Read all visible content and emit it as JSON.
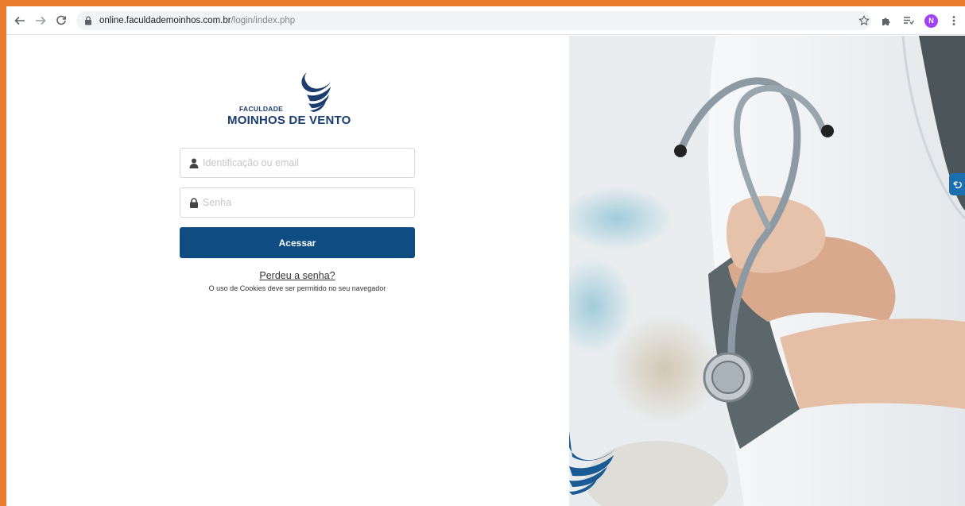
{
  "browser": {
    "url_host": "online.faculdademoinhos.com.br",
    "url_path": "/login/index.php",
    "profile_initial": "N"
  },
  "brand": {
    "name_small": "FACULDADE",
    "name_big": "MOINHOS DE VENTO",
    "color": "#1a3d6d"
  },
  "login": {
    "username_placeholder": "Identificação ou email",
    "password_placeholder": "Senha",
    "submit_label": "Acessar",
    "forgot_label": "Perdeu a senha?",
    "cookie_note": "O uso de Cookies deve ser permitido no seu navegador",
    "button_color": "#0f4c81"
  },
  "icons": {
    "back": "arrow-left-icon",
    "forward": "arrow-right-icon",
    "reload": "reload-icon",
    "secure": "lock-icon",
    "bookmark": "star-icon",
    "extensions": "puzzle-icon",
    "reading_list": "reading-list-icon",
    "menu": "kebab-menu-icon",
    "user_field": "user-icon",
    "password_field": "padlock-icon",
    "accessibility": "sign-language-icon"
  },
  "page_border_color": "#ea7a2e"
}
